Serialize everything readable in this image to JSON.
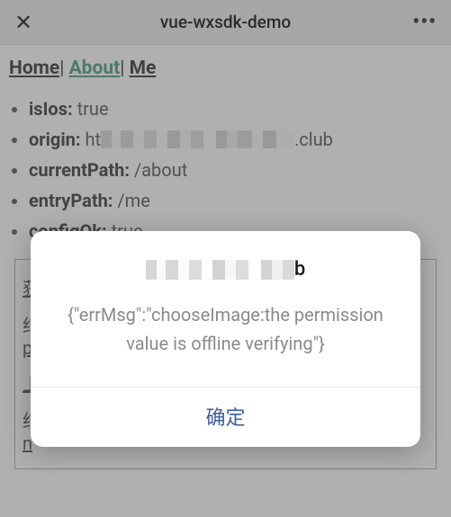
{
  "header": {
    "title": "vue-wxsdk-demo"
  },
  "nav": {
    "home": "Home",
    "about": "About",
    "me": "Me"
  },
  "info": {
    "items": [
      {
        "key": "isIos:",
        "value": "true"
      },
      {
        "key": "origin:",
        "value_prefix": "ht",
        "value_suffix": ".club",
        "obscured": true
      },
      {
        "key": "currentPath:",
        "value": "/about"
      },
      {
        "key": "entryPath:",
        "value": "/me"
      },
      {
        "key": "configOk:",
        "value": "true"
      }
    ]
  },
  "underlay": {
    "row1": "获",
    "row2_a": "结",
    "row2_b": "pe",
    "row3": "上",
    "row4_a": "结",
    "row4_b": "n"
  },
  "modal": {
    "title_suffix": "b",
    "message": "{\"errMsg\":\"chooseImage:the permission value is offline verifying\"}",
    "ok": "确定"
  }
}
